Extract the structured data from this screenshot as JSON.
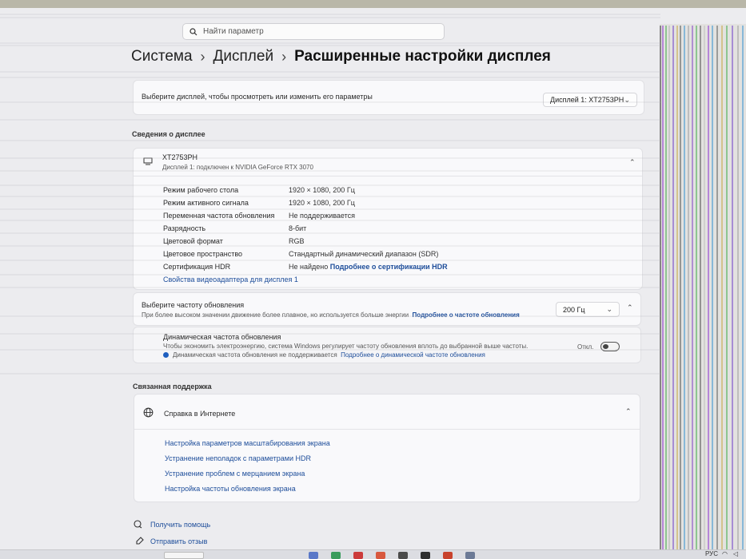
{
  "search": {
    "placeholder": "Найти параметр"
  },
  "breadcrumb": {
    "root": "Система",
    "parent": "Дисплей",
    "current": "Расширенные настройки дисплея"
  },
  "display_select": {
    "label": "Выберите дисплей, чтобы просмотреть или изменить его параметры",
    "value": "Дисплей 1: XT2753PH"
  },
  "display_info": {
    "section_title": "Сведения о дисплее",
    "name": "XT2753PH",
    "subtitle": "Дисплей 1: подключен к NVIDIA GeForce RTX 3070",
    "properties": [
      {
        "key": "Режим рабочего стола",
        "value": "1920 × 1080, 200 Гц"
      },
      {
        "key": "Режим активного сигнала",
        "value": "1920 × 1080, 200 Гц"
      },
      {
        "key": "Переменная частота обновления",
        "value": "Не поддерживается"
      },
      {
        "key": "Разрядность",
        "value": "8-бит"
      },
      {
        "key": "Цветовой формат",
        "value": "RGB"
      },
      {
        "key": "Цветовое пространство",
        "value": "Стандартный динамический диапазон (SDR)"
      }
    ],
    "hdr_key": "Сертификация HDR",
    "hdr_value": "Не найдено",
    "hdr_link": "Подробнее о сертификации HDR",
    "adapter_link": "Свойства видеоадаптера для дисплея 1"
  },
  "refresh": {
    "title": "Выберите частоту обновления",
    "description": "При более высоком значении движение более плавное, но используется больше энергии",
    "link": "Подробнее о частоте обновления",
    "value": "200 Гц",
    "dynamic_title": "Динамическая частота обновления",
    "dynamic_description": "Чтобы экономить электроэнергию, система Windows регулирует частоту обновления вплоть до выбранной выше частоты.",
    "toggle_label": "Откл.",
    "toggle_on": false,
    "not_supported": "Динамическая частота обновления не поддерживается",
    "dynamic_link": "Подробнее о динамической частоте обновления"
  },
  "support": {
    "section_title": "Связанная поддержка",
    "card_title": "Справка в Интернете",
    "links": [
      "Настройка параметров масштабирования экрана",
      "Устранение неполадок с параметрами HDR",
      "Устранение проблем с мерцанием экрана",
      "Настройка частоты обновления экрана"
    ]
  },
  "footer": {
    "help": "Получить помощь",
    "feedback": "Отправить отзыв"
  },
  "taskbar": {
    "lang": "РУС"
  },
  "colors": {
    "accent": "#1d4d9a",
    "info": "#1f5fbf",
    "background": "#ececef"
  }
}
